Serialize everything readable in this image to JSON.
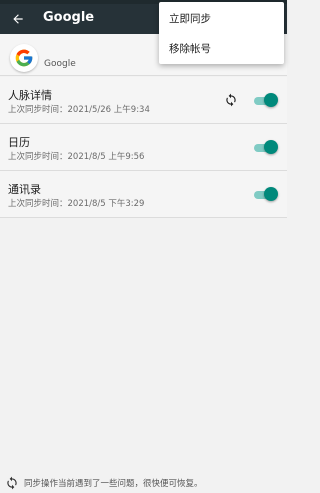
{
  "toolbar": {
    "title": "Google",
    "back_icon": "arrow-back-icon",
    "background": "#263238"
  },
  "account": {
    "name": "Google",
    "logo_icon": "google-logo-icon"
  },
  "menu": {
    "items": [
      "立即同步",
      "移除帐号"
    ]
  },
  "rows": [
    {
      "title": "人脉详情",
      "subtitle": "上次同步时间：2021/5/26 上午9:34",
      "enabled": true,
      "syncing": true
    },
    {
      "title": "日历",
      "subtitle": "上次同步时间：2021/8/5 上午9:56",
      "enabled": true,
      "syncing": false
    },
    {
      "title": "通讯录",
      "subtitle": "上次同步时间：2021/8/5 下午3:29",
      "enabled": true,
      "syncing": false
    }
  ],
  "footer": {
    "text": "同步操作当前遇到了一些问题，很快便可恢复。",
    "icon": "sync-problem-icon"
  },
  "colors": {
    "accent": "#00897b",
    "track": "#80cbc4"
  }
}
